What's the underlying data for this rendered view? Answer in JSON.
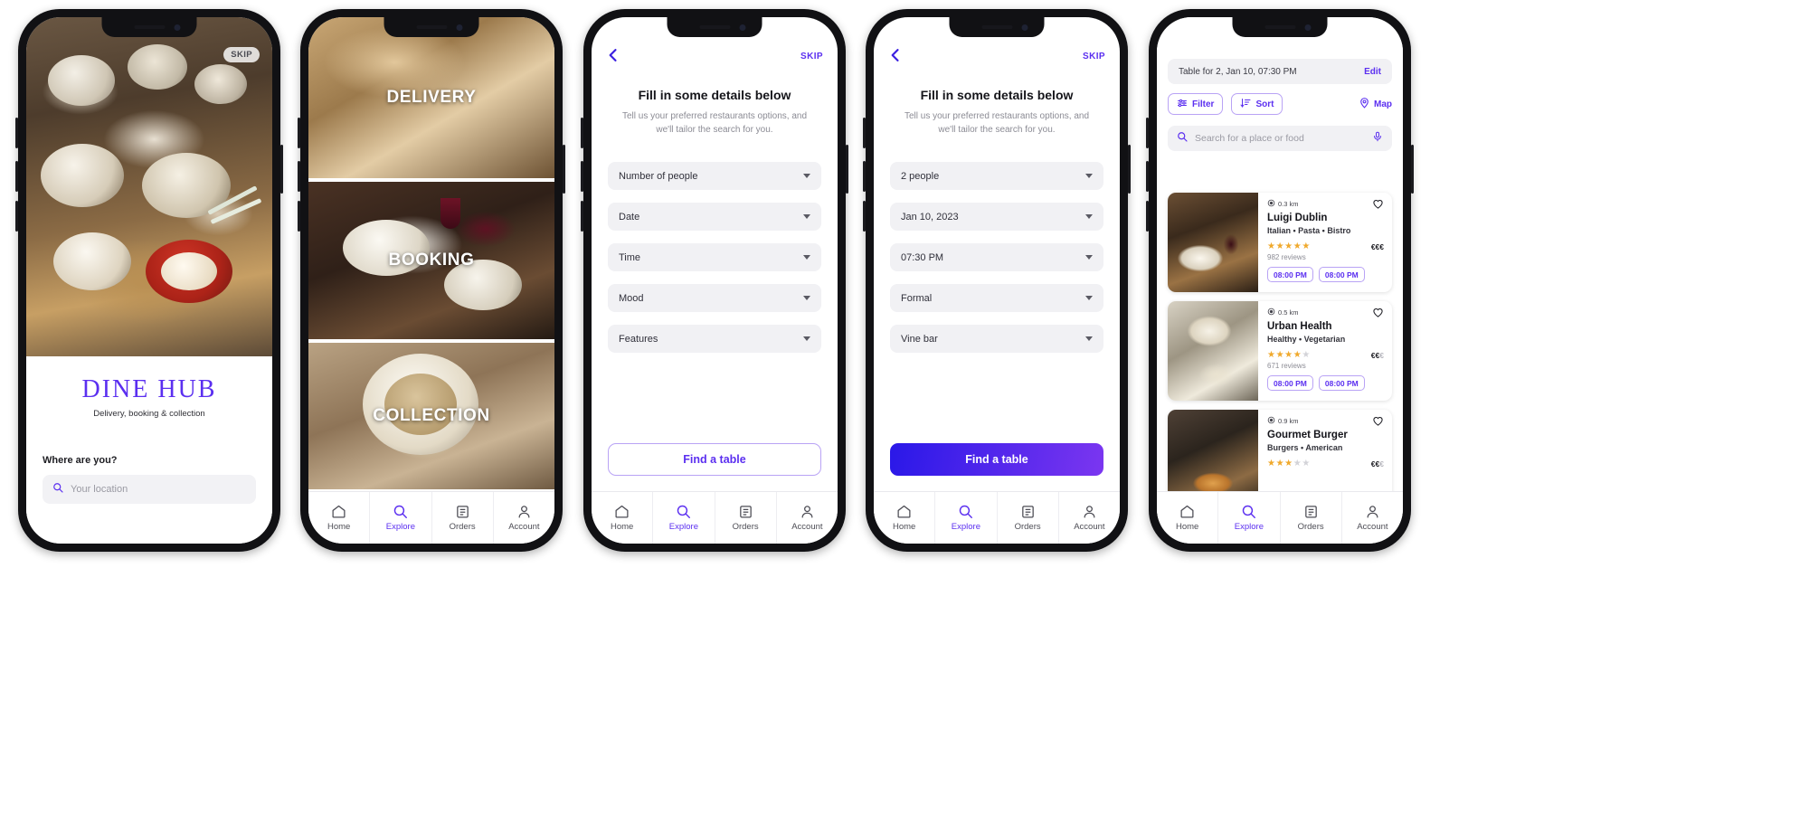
{
  "app": {
    "brand": "DINE HUB",
    "tagline": "Delivery, booking & collection",
    "accent": "#5b2ff0",
    "accent_soft": "#b9a3f5",
    "field_bg": "#f1f1f4"
  },
  "tabbar": {
    "items": [
      {
        "label": "Home",
        "icon": "home-icon",
        "active": false
      },
      {
        "label": "Explore",
        "icon": "search-icon",
        "active": true
      },
      {
        "label": "Orders",
        "icon": "clipboard-icon",
        "active": false
      },
      {
        "label": "Account",
        "icon": "person-icon",
        "active": false
      }
    ]
  },
  "screen1": {
    "skip": "SKIP",
    "brand": "DINE HUB",
    "tagline": "Delivery, booking & collection",
    "location_label": "Where are you?",
    "location_placeholder": "Your location",
    "search_icon": "search-icon"
  },
  "screen2": {
    "bands": [
      {
        "label": "DELIVERY"
      },
      {
        "label": "BOOKING"
      },
      {
        "label": "COLLECTION"
      }
    ]
  },
  "screen3": {
    "skip": "SKIP",
    "back_icon": "chevron-left-icon",
    "title": "Fill in some details below",
    "subtitle": "Tell us your preferred restaurants options, and we'll tailor the search for you.",
    "fields": [
      {
        "name": "number-of-people",
        "value": "Number of people"
      },
      {
        "name": "date",
        "value": "Date"
      },
      {
        "name": "time",
        "value": "Time"
      },
      {
        "name": "mood",
        "value": "Mood"
      },
      {
        "name": "features",
        "value": "Features"
      }
    ],
    "cta": "Find a table"
  },
  "screen4": {
    "skip": "SKIP",
    "back_icon": "chevron-left-icon",
    "title": "Fill in some details below",
    "subtitle": "Tell us your preferred restaurants options, and we'll tailor the search for you.",
    "fields": [
      {
        "name": "number-of-people",
        "value": "2 people"
      },
      {
        "name": "date",
        "value": "Jan 10, 2023"
      },
      {
        "name": "time",
        "value": "07:30 PM"
      },
      {
        "name": "mood",
        "value": "Formal"
      },
      {
        "name": "features",
        "value": "Vine bar"
      }
    ],
    "cta": "Find a table"
  },
  "screen5": {
    "reservation": "Table for 2, Jan 10, 07:30 PM",
    "edit": "Edit",
    "filter": "Filter",
    "sort": "Sort",
    "map": "Map",
    "search_placeholder": "Search for a place or food",
    "mic_icon": "microphone-icon",
    "restaurants": [
      {
        "distance": "0.3 km",
        "name": "Luigi Dublin",
        "categories": "Italian • Pasta • Bistro",
        "rating": 5,
        "price": "€€€",
        "price_max": 3,
        "reviews": "982 reviews",
        "slots": [
          "08:00 PM",
          "08:00 PM"
        ]
      },
      {
        "distance": "0.5 km",
        "name": "Urban Health",
        "categories": "Healthy • Vegetarian",
        "rating": 4,
        "price": "€€€",
        "price_max": 3,
        "reviews": "671 reviews",
        "slots": [
          "08:00 PM",
          "08:00 PM"
        ]
      },
      {
        "distance": "0.9 km",
        "name": "Gourmet Burger",
        "categories": "Burgers • American",
        "rating": 3,
        "price": "€€€",
        "price_max": 3,
        "reviews": "",
        "slots": []
      }
    ]
  }
}
